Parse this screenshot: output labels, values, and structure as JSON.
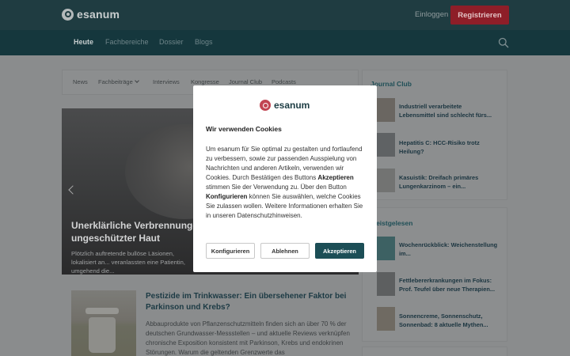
{
  "header": {
    "logo_text": "esanum",
    "login_label": "Einloggen",
    "register_label": "Registrieren"
  },
  "nav": {
    "items": [
      {
        "label": "Heute",
        "active": true
      },
      {
        "label": "Fachbereiche",
        "active": false
      },
      {
        "label": "Dossier",
        "active": false
      },
      {
        "label": "Blogs",
        "active": false
      }
    ],
    "search_icon": "search-icon"
  },
  "subnav": {
    "items": [
      "News",
      "Fachbeiträge",
      "Interviews",
      "Kongresse",
      "Journal Club",
      "Podcasts"
    ]
  },
  "hero": {
    "title": "Unerklärliche Verbrennungen auf ungeschützter Haut",
    "description": "Plötzlich auftretende bullöse Läsionen, lokalisiert an... veranlassten eine Patientin, umgehend die..."
  },
  "article": {
    "title": "Pestizide im Trinkwasser: Ein übersehener Faktor bei Parkinson und Krebs?",
    "text": "Abbauprodukte von Pflanzenschutzmitteln finden sich an über 70 % der deutschen Grundwasser-Messstellen – und aktuelle Reviews verknüpfen chronische Exposition konsistent mit Parkinson, Krebs und endokrinen Störungen. Warum die geltenden Grenzwerte das"
  },
  "sidebar": {
    "journal_club": {
      "heading": "Journal Club",
      "items": [
        "Industriell verarbeitete Lebensmittel sind schlecht fürs...",
        "Hepatitis C: HCC-Risiko trotz Heilung?",
        "Kasuistik: Dreifach primäres Lungenkarzinom – ein..."
      ]
    },
    "meistgelesen": {
      "heading": "Meistgelesen",
      "items": [
        "Wochenrückblick: Weichenstellung im...",
        "Fettlebererkrankungen im Fokus: Prof. Teufel über neue Therapien...",
        "Sonnencreme, Sonnenschutz, Sonnenbad: 8 aktuelle Mythen..."
      ]
    }
  },
  "cookie": {
    "logo_text": "esanum",
    "title": "Wir verwenden Cookies",
    "body_1": "Um esanum für Sie optimal zu gestalten und fortlaufend zu verbessern, sowie zur passenden Ausspielung von Nachrichten und anderen Artikeln, verwenden wir Cookies. Durch Bestätigen des Buttons ",
    "body_accept_word": "Akzeptieren",
    "body_2": " stimmen Sie der Verwendung zu. Über den Button ",
    "body_configure_word": "Konfigurieren",
    "body_3": " können Sie auswählen, welche Cookies Sie zulassen wollen. Weitere Informationen erhalten Sie in unseren Datenschutzhinweisen.",
    "configure_label": "Konfigurieren",
    "decline_label": "Ablehnen",
    "accept_label": "Akzeptieren"
  },
  "colors": {
    "topbar": "#1f3c41",
    "register": "#8e1e28",
    "accent": "#1c4e56"
  }
}
